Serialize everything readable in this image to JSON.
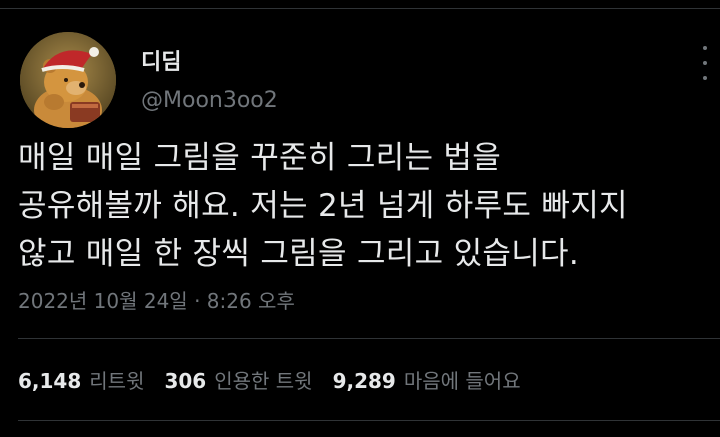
{
  "author": {
    "display_name": "디딤",
    "handle": "@Moon3oo2"
  },
  "tweet": {
    "lines": [
      "매일 매일 그림을 꾸준히 그리는 법을",
      "공유해볼까 해요. 저는 2년 넘게 하루도 빠지지",
      "않고 매일 한 장씩 그림을 그리고 있습니다."
    ],
    "timestamp": "2022년 10월 24일 · 8:26 오후"
  },
  "stats": {
    "retweets": {
      "count": "6,148",
      "label": "리트윗"
    },
    "quotes": {
      "count": "306",
      "label": "인용한 트윗"
    },
    "likes": {
      "count": "9,289",
      "label": "마음에 들어요"
    }
  },
  "icons": {
    "more": "more-dots-icon"
  },
  "colors": {
    "background": "#000000",
    "primary_text": "#e7e9ea",
    "secondary_text": "#71767b",
    "divider": "#2f3336"
  }
}
